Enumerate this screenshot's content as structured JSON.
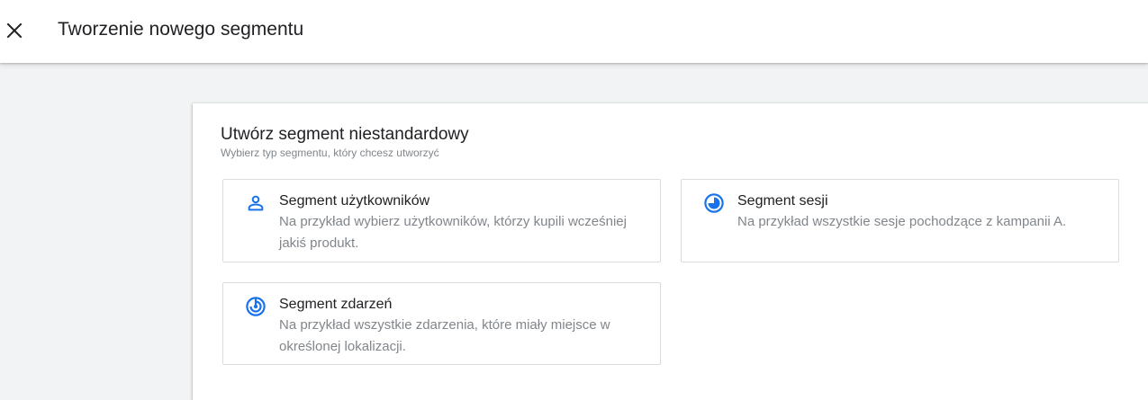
{
  "header": {
    "title": "Tworzenie nowego segmentu",
    "close_icon": "close-icon"
  },
  "card": {
    "title": "Utwórz segment niestandardowy",
    "subtitle": "Wybierz typ segmentu, który chcesz utworzyć"
  },
  "options": [
    {
      "icon": "person-icon",
      "title": "Segment użytkowników",
      "description": "Na przykład wybierz użytkowników, którzy kupili wcześniej jakiś produkt."
    },
    {
      "icon": "session-timer-icon",
      "title": "Segment sesji",
      "description": "Na przykład wszystkie sesje pochodzące z kampanii A."
    },
    {
      "icon": "event-target-icon",
      "title": "Segment zdarzeń",
      "description": "Na przykład wszystkie zdarzenia, które miały miejsce w określonej lokalizacji."
    }
  ],
  "colors": {
    "accent": "#1a73e8",
    "secondary_text": "#80868b",
    "primary_text": "#202124",
    "background": "#f1f3f4"
  }
}
